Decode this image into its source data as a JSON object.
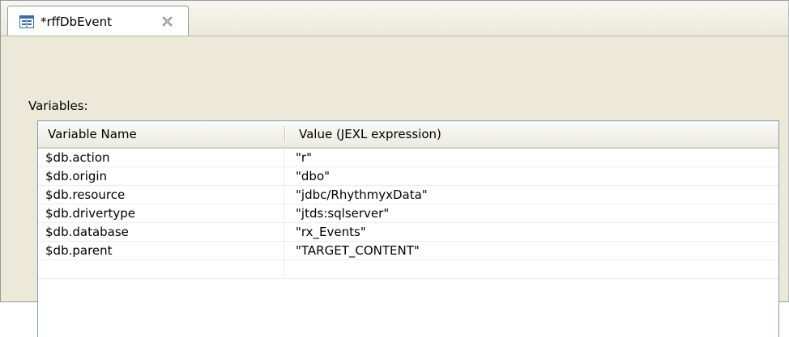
{
  "editor": {
    "tab": {
      "title": "*rffDbEvent",
      "icon": "form-editor-icon",
      "close_icon": "close-icon"
    }
  },
  "variables_section": {
    "label": "Variables:",
    "columns": [
      "Variable Name",
      "Value (JEXL expression)"
    ],
    "rows": [
      {
        "name": "$db.action",
        "value": "\"r\""
      },
      {
        "name": "$db.origin",
        "value": "\"dbo\""
      },
      {
        "name": "$db.resource",
        "value": "\"jdbc/RhythmyxData\""
      },
      {
        "name": "$db.drivertype",
        "value": "\"jtds:sqlserver\""
      },
      {
        "name": "$db.database",
        "value": "\"rx_Events\""
      },
      {
        "name": "$db.parent",
        "value": "\"TARGET_CONTENT\""
      },
      {
        "name": "",
        "value": ""
      }
    ]
  },
  "colors": {
    "background": "#ece9d8",
    "table_border": "#7f9db9",
    "icon_blue": "#3a6ea5"
  }
}
